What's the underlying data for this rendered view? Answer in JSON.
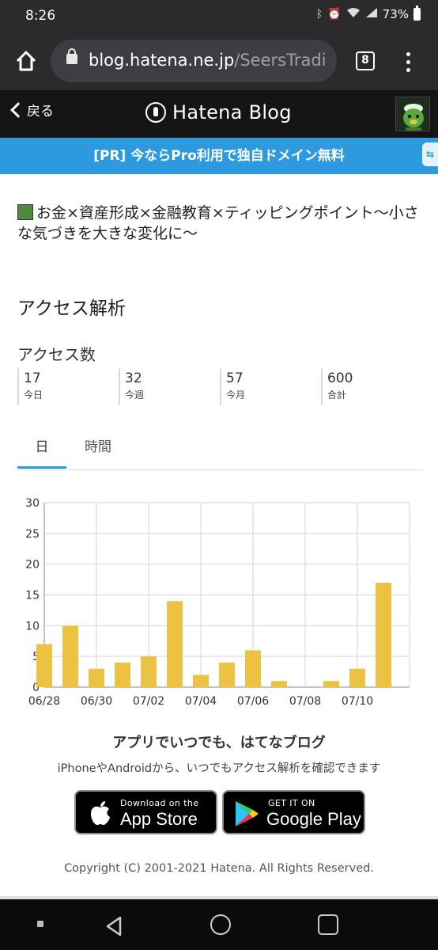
{
  "status": {
    "time": "8:26",
    "battery": "73%"
  },
  "browser": {
    "url_host": "blog.hatena.ne.jp",
    "url_path": "/SeersTradi",
    "tab_count": "8"
  },
  "header": {
    "back_label": "戻る",
    "brand": "Hatena Blog"
  },
  "banner": {
    "text": "[PR] 今ならPro利用で独自ドメイン無料",
    "side_tab": "⇆"
  },
  "blog": {
    "title": "お金×資産形成×金融教育×ティッピングポイント〜小さな気づきを大きな変化に〜"
  },
  "analytics": {
    "title": "アクセス解析",
    "access_heading": "アクセス数",
    "stats": [
      {
        "value": "17",
        "label": "今日"
      },
      {
        "value": "32",
        "label": "今週"
      },
      {
        "value": "57",
        "label": "今月"
      },
      {
        "value": "600",
        "label": "合計"
      }
    ],
    "tabs": [
      "日",
      "時間"
    ]
  },
  "chart_data": {
    "type": "bar",
    "categories": [
      "06/28",
      "06/29",
      "06/30",
      "07/01",
      "07/02",
      "07/03",
      "07/04",
      "07/05",
      "07/06",
      "07/07",
      "07/08",
      "07/09",
      "07/10",
      "07/11"
    ],
    "tick_labels": [
      "06/28",
      "06/30",
      "07/02",
      "07/04",
      "07/06",
      "07/08",
      "07/10"
    ],
    "values": [
      7,
      10,
      3,
      4,
      5,
      14,
      2,
      4,
      6,
      1,
      0,
      1,
      3,
      17
    ],
    "ylim": [
      0,
      30
    ],
    "yticks": [
      0,
      5,
      10,
      15,
      20,
      25,
      30
    ],
    "grid": true,
    "bar_color": "#edc242"
  },
  "promo": {
    "title": "アプリでいつでも、はてなブログ",
    "subtitle": "iPhoneやAndroidから、いつでもアクセス解析を確認できます",
    "apple_small": "Download on the",
    "apple_big": "App Store",
    "google_small": "GET IT ON",
    "google_big": "Google Play"
  },
  "footer": {
    "copyright": "Copyright (C) 2001-2021 Hatena. All Rights Reserved."
  }
}
